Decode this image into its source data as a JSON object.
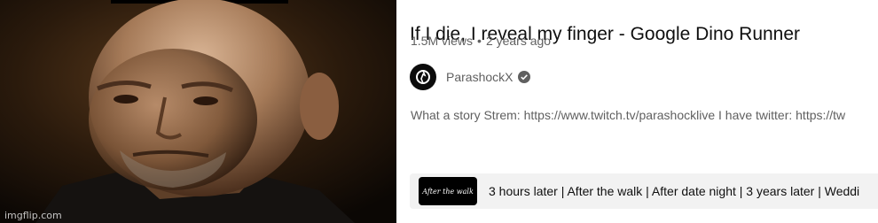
{
  "thumbnail": {
    "watermark": "imgflip.com"
  },
  "video": {
    "title": "If I die, I reveal my finger - Google Dino Runner",
    "views": "1.5M views",
    "separator": "•",
    "age": "2 years ago"
  },
  "channel": {
    "name": "ParashockX",
    "verified": true
  },
  "description": {
    "snippet": "What a story Strem: https://www.twitch.tv/parashocklive I have twitter: https://tw"
  },
  "chapters": {
    "thumb_label": "After the walk",
    "text": "3 hours later | After the walk | After date night | 3 years later | Weddi"
  },
  "colors": {
    "title": "#0f0f0f",
    "secondary": "#606060",
    "chapter_bg": "#f2f2f2"
  }
}
